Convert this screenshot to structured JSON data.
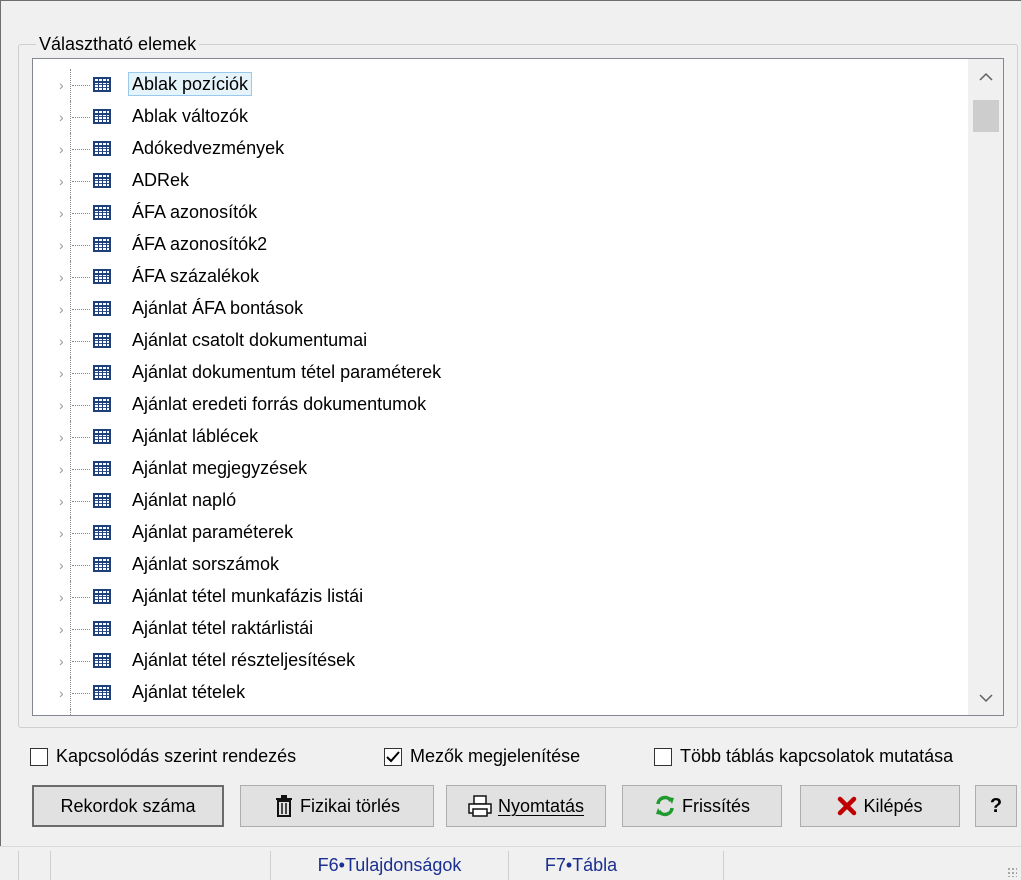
{
  "group": {
    "label": "Választható elemek"
  },
  "tree": {
    "items": [
      {
        "label": "Ablak pozíciók",
        "selected": true
      },
      {
        "label": "Ablak változók"
      },
      {
        "label": "Adókedvezmények"
      },
      {
        "label": "ADRek"
      },
      {
        "label": "ÁFA azonosítók"
      },
      {
        "label": "ÁFA azonosítók2"
      },
      {
        "label": "ÁFA százalékok"
      },
      {
        "label": "Ajánlat ÁFA bontások"
      },
      {
        "label": "Ajánlat csatolt dokumentumai"
      },
      {
        "label": "Ajánlat dokumentum tétel paraméterek"
      },
      {
        "label": "Ajánlat eredeti forrás dokumentumok"
      },
      {
        "label": "Ajánlat láblécek"
      },
      {
        "label": "Ajánlat megjegyzések"
      },
      {
        "label": "Ajánlat napló"
      },
      {
        "label": "Ajánlat paraméterek"
      },
      {
        "label": "Ajánlat sorszámok"
      },
      {
        "label": "Ajánlat tétel munkafázis listái"
      },
      {
        "label": "Ajánlat tétel raktárlistái"
      },
      {
        "label": "Ajánlat tétel részteljesítések"
      },
      {
        "label": "Ajánlat tételek"
      },
      {
        "label": ""
      }
    ],
    "icon": "table-icon",
    "expander_icon": "chevron-right-icon"
  },
  "options": {
    "sort_by_link": {
      "label": "Kapcsolódás szerint rendezés",
      "checked": false
    },
    "show_fields": {
      "label": "Mezők megjelenítése",
      "checked": true
    },
    "show_multi_table": {
      "label": "Több táblás kapcsolatok mutatása",
      "checked": false
    }
  },
  "buttons": {
    "record_count": "Rekordok száma",
    "physical_delete": "Fizikai törlés",
    "print": "Nyomtatás",
    "refresh": "Frissítés",
    "exit": "Kilépés",
    "help": "?"
  },
  "statusbar": {
    "f6": "F6•Tulajdonságok",
    "f7": "F7•Tábla"
  },
  "colors": {
    "selection_border": "#99c9ef",
    "statusbar_text": "#1a2f8f",
    "exit_icon": "#c00000",
    "refresh_icon": "#1f9a2e"
  }
}
